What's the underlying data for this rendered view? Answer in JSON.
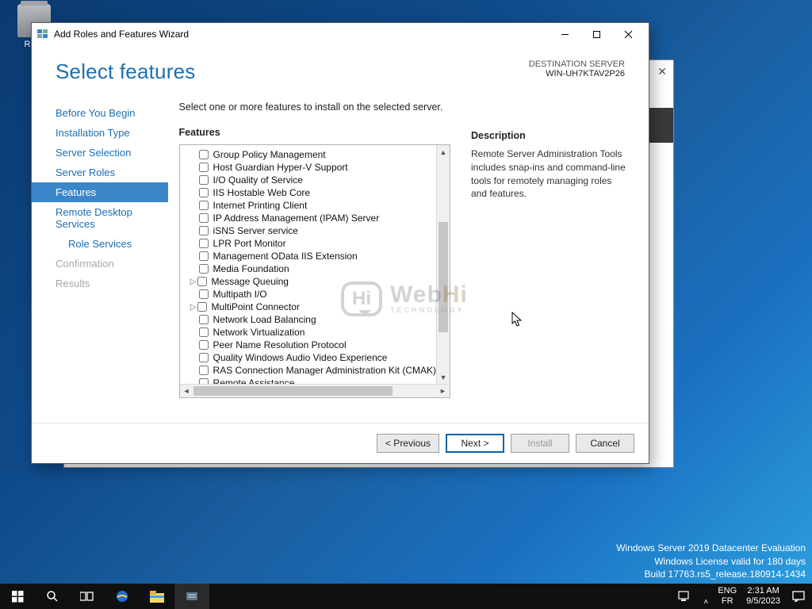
{
  "desktop": {
    "recycle_bin": "Recy"
  },
  "watermark": {
    "l1": "Windows Server 2019 Datacenter Evaluation",
    "l2": "Windows License valid for 180 days",
    "l3": "Build 17763.rs5_release.180914-1434"
  },
  "taskbar": {
    "lang1": "ENG",
    "lang2": "FR",
    "time": "2:31 AM",
    "date": "9/5/2023"
  },
  "wizard": {
    "title": "Add Roles and Features Wizard",
    "heading": "Select features",
    "dest_label": "DESTINATION SERVER",
    "dest_host": "WIN-UH7KTAV2P26",
    "nav": {
      "before": "Before You Begin",
      "install_type": "Installation Type",
      "selection": "Server Selection",
      "roles": "Server Roles",
      "features": "Features",
      "rds": "Remote Desktop Services",
      "role_services": "Role Services",
      "confirm": "Confirmation",
      "results": "Results"
    },
    "intro": "Select one or more features to install on the selected server.",
    "features_label": "Features",
    "description_label": "Description",
    "description_text": "Remote Server Administration Tools includes snap-ins and command-line tools for remotely managing roles and features.",
    "items": [
      {
        "label": "Group Policy Management"
      },
      {
        "label": "Host Guardian Hyper-V Support"
      },
      {
        "label": "I/O Quality of Service"
      },
      {
        "label": "IIS Hostable Web Core"
      },
      {
        "label": "Internet Printing Client"
      },
      {
        "label": "IP Address Management (IPAM) Server"
      },
      {
        "label": "iSNS Server service"
      },
      {
        "label": "LPR Port Monitor"
      },
      {
        "label": "Management OData IIS Extension"
      },
      {
        "label": "Media Foundation"
      },
      {
        "label": "Message Queuing",
        "expandable": true
      },
      {
        "label": "Multipath I/O"
      },
      {
        "label": "MultiPoint Connector",
        "expandable": true
      },
      {
        "label": "Network Load Balancing"
      },
      {
        "label": "Network Virtualization"
      },
      {
        "label": "Peer Name Resolution Protocol"
      },
      {
        "label": "Quality Windows Audio Video Experience"
      },
      {
        "label": "RAS Connection Manager Administration Kit (CMAK)"
      },
      {
        "label": "Remote Assistance"
      }
    ],
    "buttons": {
      "prev": "< Previous",
      "next": "Next >",
      "install": "Install",
      "cancel": "Cancel"
    }
  },
  "logo": {
    "bubble": "Hi",
    "web": "Web",
    "hi": "Hi",
    "tech": "TECHNOLOGY"
  }
}
